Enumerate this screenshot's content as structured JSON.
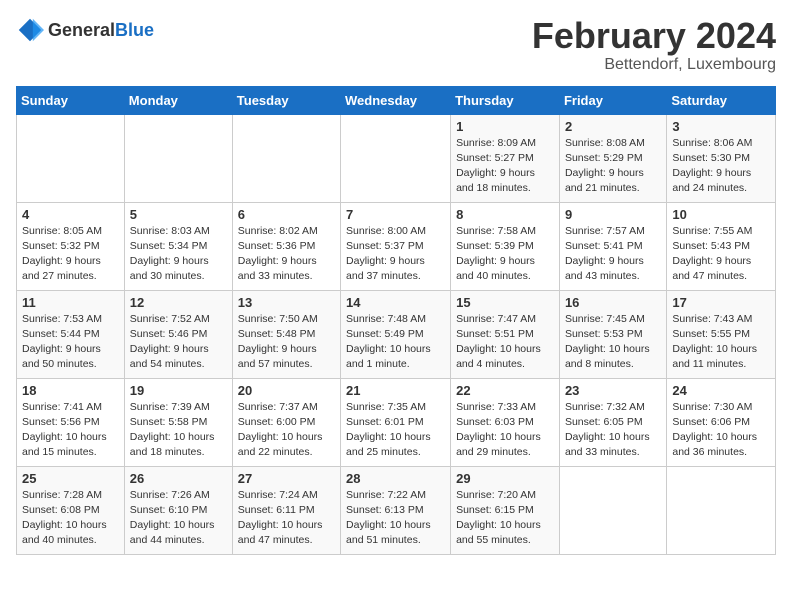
{
  "logo": {
    "general": "General",
    "blue": "Blue"
  },
  "header": {
    "title": "February 2024",
    "subtitle": "Bettendorf, Luxembourg"
  },
  "weekdays": [
    "Sunday",
    "Monday",
    "Tuesday",
    "Wednesday",
    "Thursday",
    "Friday",
    "Saturday"
  ],
  "weeks": [
    [
      {
        "day": "",
        "info": ""
      },
      {
        "day": "",
        "info": ""
      },
      {
        "day": "",
        "info": ""
      },
      {
        "day": "",
        "info": ""
      },
      {
        "day": "1",
        "info": "Sunrise: 8:09 AM\nSunset: 5:27 PM\nDaylight: 9 hours\nand 18 minutes."
      },
      {
        "day": "2",
        "info": "Sunrise: 8:08 AM\nSunset: 5:29 PM\nDaylight: 9 hours\nand 21 minutes."
      },
      {
        "day": "3",
        "info": "Sunrise: 8:06 AM\nSunset: 5:30 PM\nDaylight: 9 hours\nand 24 minutes."
      }
    ],
    [
      {
        "day": "4",
        "info": "Sunrise: 8:05 AM\nSunset: 5:32 PM\nDaylight: 9 hours\nand 27 minutes."
      },
      {
        "day": "5",
        "info": "Sunrise: 8:03 AM\nSunset: 5:34 PM\nDaylight: 9 hours\nand 30 minutes."
      },
      {
        "day": "6",
        "info": "Sunrise: 8:02 AM\nSunset: 5:36 PM\nDaylight: 9 hours\nand 33 minutes."
      },
      {
        "day": "7",
        "info": "Sunrise: 8:00 AM\nSunset: 5:37 PM\nDaylight: 9 hours\nand 37 minutes."
      },
      {
        "day": "8",
        "info": "Sunrise: 7:58 AM\nSunset: 5:39 PM\nDaylight: 9 hours\nand 40 minutes."
      },
      {
        "day": "9",
        "info": "Sunrise: 7:57 AM\nSunset: 5:41 PM\nDaylight: 9 hours\nand 43 minutes."
      },
      {
        "day": "10",
        "info": "Sunrise: 7:55 AM\nSunset: 5:43 PM\nDaylight: 9 hours\nand 47 minutes."
      }
    ],
    [
      {
        "day": "11",
        "info": "Sunrise: 7:53 AM\nSunset: 5:44 PM\nDaylight: 9 hours\nand 50 minutes."
      },
      {
        "day": "12",
        "info": "Sunrise: 7:52 AM\nSunset: 5:46 PM\nDaylight: 9 hours\nand 54 minutes."
      },
      {
        "day": "13",
        "info": "Sunrise: 7:50 AM\nSunset: 5:48 PM\nDaylight: 9 hours\nand 57 minutes."
      },
      {
        "day": "14",
        "info": "Sunrise: 7:48 AM\nSunset: 5:49 PM\nDaylight: 10 hours\nand 1 minute."
      },
      {
        "day": "15",
        "info": "Sunrise: 7:47 AM\nSunset: 5:51 PM\nDaylight: 10 hours\nand 4 minutes."
      },
      {
        "day": "16",
        "info": "Sunrise: 7:45 AM\nSunset: 5:53 PM\nDaylight: 10 hours\nand 8 minutes."
      },
      {
        "day": "17",
        "info": "Sunrise: 7:43 AM\nSunset: 5:55 PM\nDaylight: 10 hours\nand 11 minutes."
      }
    ],
    [
      {
        "day": "18",
        "info": "Sunrise: 7:41 AM\nSunset: 5:56 PM\nDaylight: 10 hours\nand 15 minutes."
      },
      {
        "day": "19",
        "info": "Sunrise: 7:39 AM\nSunset: 5:58 PM\nDaylight: 10 hours\nand 18 minutes."
      },
      {
        "day": "20",
        "info": "Sunrise: 7:37 AM\nSunset: 6:00 PM\nDaylight: 10 hours\nand 22 minutes."
      },
      {
        "day": "21",
        "info": "Sunrise: 7:35 AM\nSunset: 6:01 PM\nDaylight: 10 hours\nand 25 minutes."
      },
      {
        "day": "22",
        "info": "Sunrise: 7:33 AM\nSunset: 6:03 PM\nDaylight: 10 hours\nand 29 minutes."
      },
      {
        "day": "23",
        "info": "Sunrise: 7:32 AM\nSunset: 6:05 PM\nDaylight: 10 hours\nand 33 minutes."
      },
      {
        "day": "24",
        "info": "Sunrise: 7:30 AM\nSunset: 6:06 PM\nDaylight: 10 hours\nand 36 minutes."
      }
    ],
    [
      {
        "day": "25",
        "info": "Sunrise: 7:28 AM\nSunset: 6:08 PM\nDaylight: 10 hours\nand 40 minutes."
      },
      {
        "day": "26",
        "info": "Sunrise: 7:26 AM\nSunset: 6:10 PM\nDaylight: 10 hours\nand 44 minutes."
      },
      {
        "day": "27",
        "info": "Sunrise: 7:24 AM\nSunset: 6:11 PM\nDaylight: 10 hours\nand 47 minutes."
      },
      {
        "day": "28",
        "info": "Sunrise: 7:22 AM\nSunset: 6:13 PM\nDaylight: 10 hours\nand 51 minutes."
      },
      {
        "day": "29",
        "info": "Sunrise: 7:20 AM\nSunset: 6:15 PM\nDaylight: 10 hours\nand 55 minutes."
      },
      {
        "day": "",
        "info": ""
      },
      {
        "day": "",
        "info": ""
      }
    ]
  ]
}
